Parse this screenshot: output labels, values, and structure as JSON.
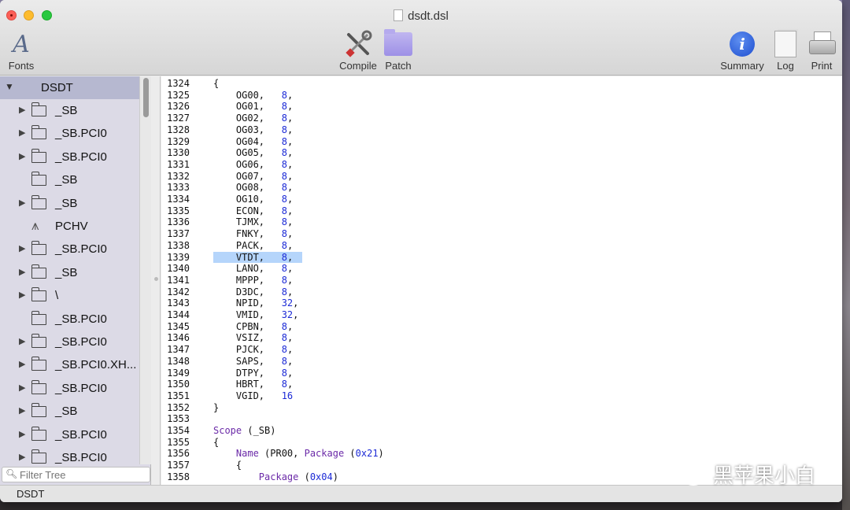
{
  "window": {
    "title": "dsdt.dsl"
  },
  "toolbar": {
    "fonts": "Fonts",
    "compile": "Compile",
    "patch": "Patch",
    "summary": "Summary",
    "log": "Log",
    "print": "Print"
  },
  "tree": {
    "root": "DSDT",
    "items": [
      {
        "label": "_SB",
        "icon": "folder",
        "expandable": true
      },
      {
        "label": "_SB.PCI0",
        "icon": "folder",
        "expandable": true
      },
      {
        "label": "_SB.PCI0",
        "icon": "folder",
        "expandable": true
      },
      {
        "label": "_SB",
        "icon": "folder",
        "expandable": false
      },
      {
        "label": "_SB",
        "icon": "folder",
        "expandable": true
      },
      {
        "label": "PCHV",
        "icon": "compass",
        "expandable": false
      },
      {
        "label": "_SB.PCI0",
        "icon": "folder",
        "expandable": true
      },
      {
        "label": "_SB",
        "icon": "folder",
        "expandable": true
      },
      {
        "label": "\\",
        "icon": "folder",
        "expandable": true
      },
      {
        "label": "_SB.PCI0",
        "icon": "folder",
        "expandable": false
      },
      {
        "label": "_SB.PCI0",
        "icon": "folder",
        "expandable": true
      },
      {
        "label": "_SB.PCI0.XH...",
        "icon": "folder",
        "expandable": true
      },
      {
        "label": "_SB.PCI0",
        "icon": "folder",
        "expandable": true
      },
      {
        "label": "_SB",
        "icon": "folder",
        "expandable": true
      },
      {
        "label": "_SB.PCI0",
        "icon": "folder",
        "expandable": true
      },
      {
        "label": "_SB.PCI0",
        "icon": "folder",
        "expandable": true
      }
    ]
  },
  "filter": {
    "placeholder": "Filter Tree"
  },
  "code": [
    {
      "n": "1324",
      "segs": [
        [
          "",
          "{"
        ]
      ]
    },
    {
      "n": "1325",
      "segs": [
        [
          "",
          "    OG00,   "
        ],
        [
          "num",
          "8"
        ],
        [
          "",
          ","
        ]
      ]
    },
    {
      "n": "1326",
      "segs": [
        [
          "",
          "    OG01,   "
        ],
        [
          "num",
          "8"
        ],
        [
          "",
          ","
        ]
      ]
    },
    {
      "n": "1327",
      "segs": [
        [
          "",
          "    OG02,   "
        ],
        [
          "num",
          "8"
        ],
        [
          "",
          ","
        ]
      ]
    },
    {
      "n": "1328",
      "segs": [
        [
          "",
          "    OG03,   "
        ],
        [
          "num",
          "8"
        ],
        [
          "",
          ","
        ]
      ]
    },
    {
      "n": "1329",
      "segs": [
        [
          "",
          "    OG04,   "
        ],
        [
          "num",
          "8"
        ],
        [
          "",
          ","
        ]
      ]
    },
    {
      "n": "1330",
      "segs": [
        [
          "",
          "    OG05,   "
        ],
        [
          "num",
          "8"
        ],
        [
          "",
          ","
        ]
      ]
    },
    {
      "n": "1331",
      "segs": [
        [
          "",
          "    OG06,   "
        ],
        [
          "num",
          "8"
        ],
        [
          "",
          ","
        ]
      ]
    },
    {
      "n": "1332",
      "segs": [
        [
          "",
          "    OG07,   "
        ],
        [
          "num",
          "8"
        ],
        [
          "",
          ","
        ]
      ]
    },
    {
      "n": "1333",
      "segs": [
        [
          "",
          "    OG08,   "
        ],
        [
          "num",
          "8"
        ],
        [
          "",
          ","
        ]
      ]
    },
    {
      "n": "1334",
      "segs": [
        [
          "",
          "    OG10,   "
        ],
        [
          "num",
          "8"
        ],
        [
          "",
          ","
        ]
      ]
    },
    {
      "n": "1335",
      "segs": [
        [
          "",
          "    ECON,   "
        ],
        [
          "num",
          "8"
        ],
        [
          "",
          ","
        ]
      ]
    },
    {
      "n": "1336",
      "segs": [
        [
          "",
          "    TJMX,   "
        ],
        [
          "num",
          "8"
        ],
        [
          "",
          ","
        ]
      ]
    },
    {
      "n": "1337",
      "segs": [
        [
          "",
          "    FNKY,   "
        ],
        [
          "num",
          "8"
        ],
        [
          "",
          ","
        ]
      ]
    },
    {
      "n": "1338",
      "segs": [
        [
          "",
          "    PACK,   "
        ],
        [
          "num",
          "8"
        ],
        [
          "",
          ","
        ]
      ]
    },
    {
      "n": "1339",
      "segs": [
        [
          "",
          "    VTDT,   "
        ],
        [
          "num",
          "8"
        ],
        [
          "",
          ","
        ]
      ],
      "highlight": true
    },
    {
      "n": "1340",
      "segs": [
        [
          "",
          "    LANO,   "
        ],
        [
          "num",
          "8"
        ],
        [
          "",
          ","
        ]
      ]
    },
    {
      "n": "1341",
      "segs": [
        [
          "",
          "    MPPP,   "
        ],
        [
          "num",
          "8"
        ],
        [
          "",
          ","
        ]
      ]
    },
    {
      "n": "1342",
      "segs": [
        [
          "",
          "    D3DC,   "
        ],
        [
          "num",
          "8"
        ],
        [
          "",
          ","
        ]
      ]
    },
    {
      "n": "1343",
      "segs": [
        [
          "",
          "    NPID,   "
        ],
        [
          "num",
          "32"
        ],
        [
          "",
          ","
        ]
      ]
    },
    {
      "n": "1344",
      "segs": [
        [
          "",
          "    VMID,   "
        ],
        [
          "num",
          "32"
        ],
        [
          "",
          ","
        ]
      ]
    },
    {
      "n": "1345",
      "segs": [
        [
          "",
          "    CPBN,   "
        ],
        [
          "num",
          "8"
        ],
        [
          "",
          ","
        ]
      ]
    },
    {
      "n": "1346",
      "segs": [
        [
          "",
          "    VSIZ,   "
        ],
        [
          "num",
          "8"
        ],
        [
          "",
          ","
        ]
      ]
    },
    {
      "n": "1347",
      "segs": [
        [
          "",
          "    PJCK,   "
        ],
        [
          "num",
          "8"
        ],
        [
          "",
          ","
        ]
      ]
    },
    {
      "n": "1348",
      "segs": [
        [
          "",
          "    SAPS,   "
        ],
        [
          "num",
          "8"
        ],
        [
          "",
          ","
        ]
      ]
    },
    {
      "n": "1349",
      "segs": [
        [
          "",
          "    DTPY,   "
        ],
        [
          "num",
          "8"
        ],
        [
          "",
          ","
        ]
      ]
    },
    {
      "n": "1350",
      "segs": [
        [
          "",
          "    HBRT,   "
        ],
        [
          "num",
          "8"
        ],
        [
          "",
          ","
        ]
      ]
    },
    {
      "n": "1351",
      "segs": [
        [
          "",
          "    VGID,   "
        ],
        [
          "num",
          "16"
        ]
      ]
    },
    {
      "n": "1352",
      "segs": [
        [
          "",
          "}"
        ]
      ]
    },
    {
      "n": "1353",
      "segs": [
        [
          "",
          ""
        ]
      ]
    },
    {
      "n": "1354",
      "segs": [
        [
          "kw",
          "Scope"
        ],
        [
          "",
          " (_SB)"
        ]
      ]
    },
    {
      "n": "1355",
      "segs": [
        [
          "",
          "{"
        ]
      ]
    },
    {
      "n": "1356",
      "segs": [
        [
          "",
          "    "
        ],
        [
          "kw",
          "Name"
        ],
        [
          "",
          " (PR00, "
        ],
        [
          "kw",
          "Package"
        ],
        [
          "",
          " ("
        ],
        [
          "num",
          "0x21"
        ],
        [
          "",
          ")"
        ]
      ]
    },
    {
      "n": "1357",
      "segs": [
        [
          "",
          "    {"
        ]
      ]
    },
    {
      "n": "1358",
      "segs": [
        [
          "",
          "        "
        ],
        [
          "kw",
          "Package"
        ],
        [
          "",
          " ("
        ],
        [
          "num",
          "0x04"
        ],
        [
          "",
          ")"
        ]
      ]
    }
  ],
  "status": {
    "text": "DSDT"
  },
  "watermark": {
    "text": "黑苹果小白"
  }
}
